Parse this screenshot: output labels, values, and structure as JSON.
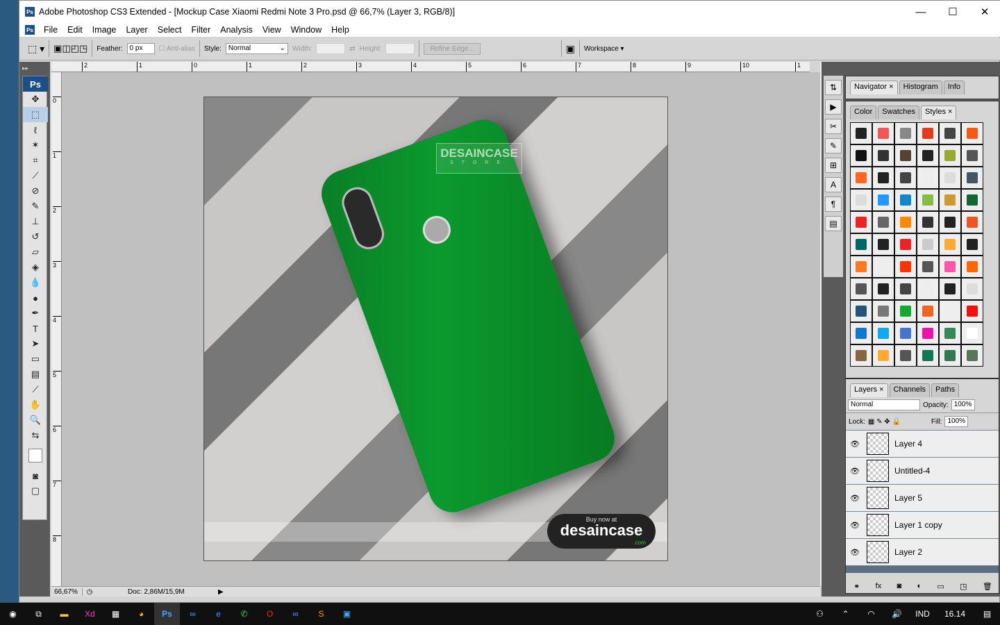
{
  "window": {
    "title": "Adobe Photoshop CS3 Extended - [Mockup Case Xiaomi Redmi Note 3 Pro.psd @ 66,7% (Layer 3, RGB/8)]",
    "app_icon": "Ps"
  },
  "menu": [
    "File",
    "Edit",
    "Image",
    "Layer",
    "Select",
    "Filter",
    "Analysis",
    "View",
    "Window",
    "Help"
  ],
  "options": {
    "feather_label": "Feather:",
    "feather_value": "0 px",
    "antialias": "Anti-alias",
    "style_label": "Style:",
    "style_value": "Normal",
    "width_label": "Width:",
    "height_label": "Height:",
    "refine": "Refine Edge...",
    "workspace": "Workspace"
  },
  "ruler": {
    "top": [
      "2",
      "1",
      "0",
      "1",
      "2",
      "3",
      "4",
      "5",
      "6",
      "7",
      "8",
      "9",
      "10",
      "1"
    ],
    "left": [
      "0",
      "1",
      "2",
      "3",
      "4",
      "5",
      "6",
      "7",
      "8"
    ]
  },
  "canvas": {
    "watermark": "DESAINCASE",
    "watermark_sub": "STORE",
    "buy_now": "Buy now at",
    "brand": "desaincase",
    "brand_tld": ".com"
  },
  "status": {
    "zoom": "66,67%",
    "doc": "Doc: 2,86M/15,9M"
  },
  "panels": {
    "top_tabs": [
      "Navigator",
      "Histogram",
      "Info"
    ],
    "mid_tabs": [
      "Color",
      "Swatches",
      "Styles"
    ],
    "styles": [
      "#222222",
      "#f55555",
      "#888888",
      "#e53a1e",
      "#444444",
      "#f55a10",
      "#111111",
      "#333333",
      "#55432f",
      "#222222",
      "#99aa33",
      "#555555",
      "#ff6622",
      "#222222",
      "#444444",
      "#eeeeee",
      "#dddddd",
      "#445566",
      "#dddddd",
      "#2299ff",
      "#1188cc",
      "#88bb44",
      "#cc9933",
      "#116633",
      "#ee2222",
      "#666666",
      "#ff8800",
      "#333333",
      "#222222",
      "#ee5522",
      "#006666",
      "#222222",
      "#ee2222",
      "#cccccc",
      "#ffaa33",
      "#222222",
      "#ff7722",
      "#eeeeee",
      "#ff3300",
      "#555555",
      "#ff55aa",
      "#ff6600",
      "#555555",
      "#222222",
      "#444444",
      "#eeeeee",
      "#222222",
      "#dddddd",
      "#225577",
      "#777777",
      "#11aa33",
      "#ee6622",
      "#eeeeee",
      "#ee1111",
      "#1177cc",
      "#11aaee",
      "#4477cc",
      "#ee11aa",
      "#338855",
      "#ffffff",
      "#886644",
      "#ffaa33",
      "#555555",
      "#117755",
      "#337755",
      "#557755"
    ],
    "layer_tabs": [
      "Layers",
      "Channels",
      "Paths"
    ],
    "blend": "Normal",
    "opacity_label": "Opacity:",
    "opacity": "100%",
    "lock_label": "Lock:",
    "fill_label": "Fill:",
    "fill": "100%",
    "layers": [
      "Layer 4",
      "Untitled-4",
      "Layer 5",
      "Layer 1 copy",
      "Layer 2"
    ]
  },
  "taskbar": {
    "lang": "IND",
    "time": "16.14"
  }
}
